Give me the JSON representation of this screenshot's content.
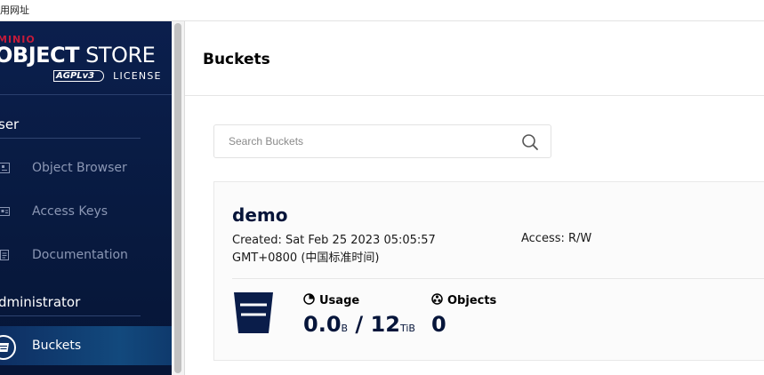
{
  "browser": {
    "top_text": "用网址"
  },
  "brand": {
    "top": "MINIO",
    "main_bold": "OBJECT",
    "main_light": "STORE",
    "badge": "AGPLv3",
    "license": "LICENSE",
    "accent_color": "#c51b3a"
  },
  "sidebar": {
    "section_user": "ser",
    "items_user": [
      {
        "label": "Object Browser",
        "icon": "object-browser-icon"
      },
      {
        "label": "Access Keys",
        "icon": "access-keys-icon"
      },
      {
        "label": "Documentation",
        "icon": "documentation-icon"
      }
    ],
    "section_admin": "dministrator",
    "items_admin": [
      {
        "label": "Buckets",
        "icon": "bucket-icon",
        "active": true
      }
    ]
  },
  "header": {
    "title": "Buckets"
  },
  "search": {
    "placeholder": "Search Buckets",
    "value": ""
  },
  "buckets": [
    {
      "name": "demo",
      "created": "Created: Sat Feb 25 2023 05:05:57 GMT+0800 (中国标准时间)",
      "access": "Access: R/W",
      "usage_label": "Usage",
      "usage_used": "0.0",
      "usage_used_unit": "B",
      "usage_sep": "/",
      "usage_total": "12",
      "usage_total_unit": "TiB",
      "objects_label": "Objects",
      "objects_value": "0"
    }
  ]
}
